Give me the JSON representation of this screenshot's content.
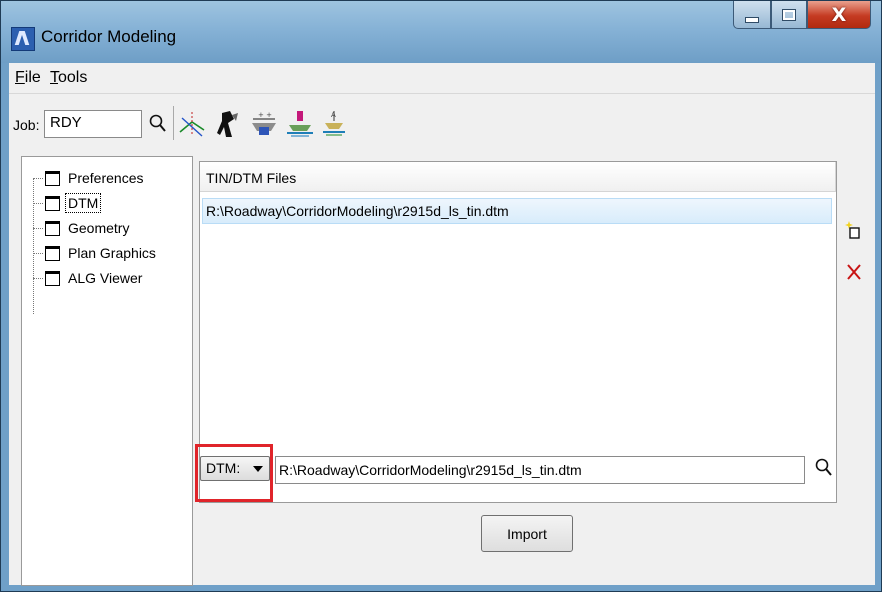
{
  "window": {
    "title": "Corridor Modeling",
    "minimize_icon": "minimize-icon",
    "maximize_icon": "maximize-icon",
    "close_glyph": "X"
  },
  "menu": {
    "items": [
      {
        "label": "File",
        "underline": "F"
      },
      {
        "label": "Tools",
        "underline": "T"
      }
    ]
  },
  "toolbar": {
    "job_label": "Job:",
    "job_value": "RDY",
    "icons": [
      "search-icon",
      "alignment-icon",
      "surveyor-icon",
      "template-icon",
      "roadway-icon",
      "superelevation-icon"
    ]
  },
  "tree": {
    "items": [
      {
        "label": "Preferences",
        "selected": false
      },
      {
        "label": "DTM",
        "selected": true
      },
      {
        "label": "Geometry",
        "selected": false
      },
      {
        "label": "Plan Graphics",
        "selected": false
      },
      {
        "label": "ALG Viewer",
        "selected": false
      }
    ]
  },
  "list": {
    "header": "TIN/DTM Files",
    "rows": [
      "R:\\Roadway\\CorridorModeling\\r2915d_ls_tin.dtm"
    ]
  },
  "side_actions": {
    "add_icon": "new-file-icon",
    "delete_icon": "delete-x-icon"
  },
  "bottom": {
    "type_select": "DTM:",
    "path_value": "R:\\Roadway\\CorridorModeling\\r2915d_ls_tin.dtm",
    "import_label": "Import"
  },
  "colors": {
    "highlight": "#e0242a",
    "selection": "#d8ecfb",
    "title_bar": "#86b2d6"
  }
}
